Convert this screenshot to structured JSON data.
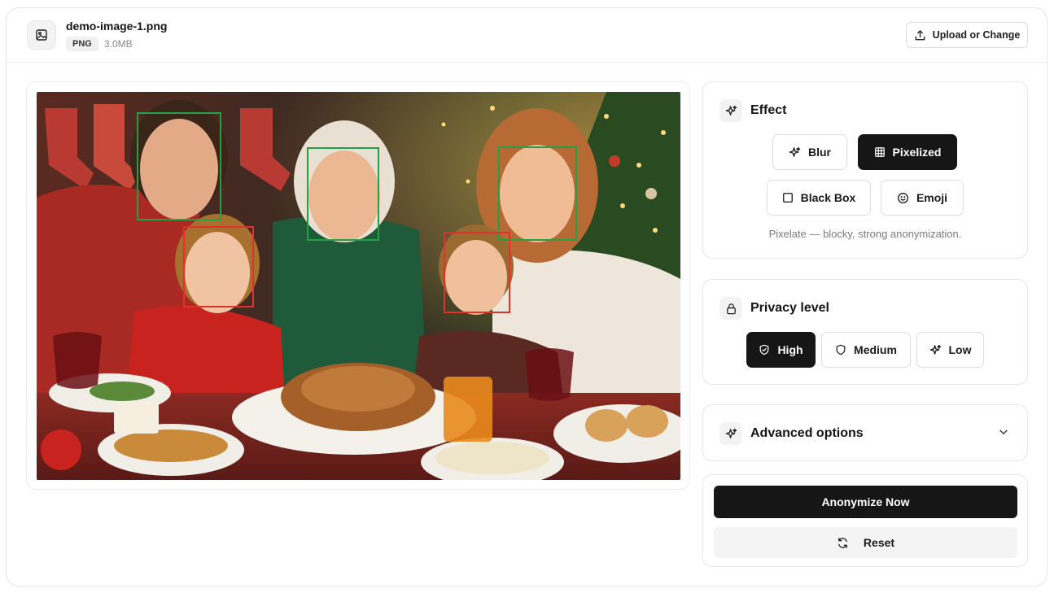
{
  "file": {
    "name": "demo-image-1.png",
    "type": "PNG",
    "size": "3.0MB"
  },
  "header": {
    "upload_label": "Upload or Change"
  },
  "effect": {
    "title": "Effect",
    "options": [
      {
        "label": "Blur",
        "icon": "sparkle-icon",
        "selected": false
      },
      {
        "label": "Pixelized",
        "icon": "grid-icon",
        "selected": true
      },
      {
        "label": "Black Box",
        "icon": "square-icon",
        "selected": false
      },
      {
        "label": "Emoji",
        "icon": "smiley-icon",
        "selected": false
      }
    ],
    "hint": "Pixelate — blocky, strong anonymization."
  },
  "privacy": {
    "title": "Privacy level",
    "options": [
      {
        "label": "High",
        "icon": "shield-check-icon",
        "selected": true
      },
      {
        "label": "Medium",
        "icon": "shield-icon",
        "selected": false
      },
      {
        "label": "Low",
        "icon": "sparkle-icon",
        "selected": false
      }
    ]
  },
  "advanced": {
    "title": "Advanced options",
    "expanded": false
  },
  "actions": {
    "primary_label": "Anonymize Now",
    "reset_label": "Reset"
  },
  "faces": [
    {
      "status": "kept",
      "color": "#22a243"
    },
    {
      "status": "kept",
      "color": "#22a243"
    },
    {
      "status": "kept",
      "color": "#22a243"
    },
    {
      "status": "anonymize",
      "color": "#e0312b"
    },
    {
      "status": "anonymize",
      "color": "#e0312b"
    }
  ],
  "colors": {
    "accent_dark": "#161616",
    "face_kept": "#22a243",
    "face_flagged": "#e0312b"
  }
}
